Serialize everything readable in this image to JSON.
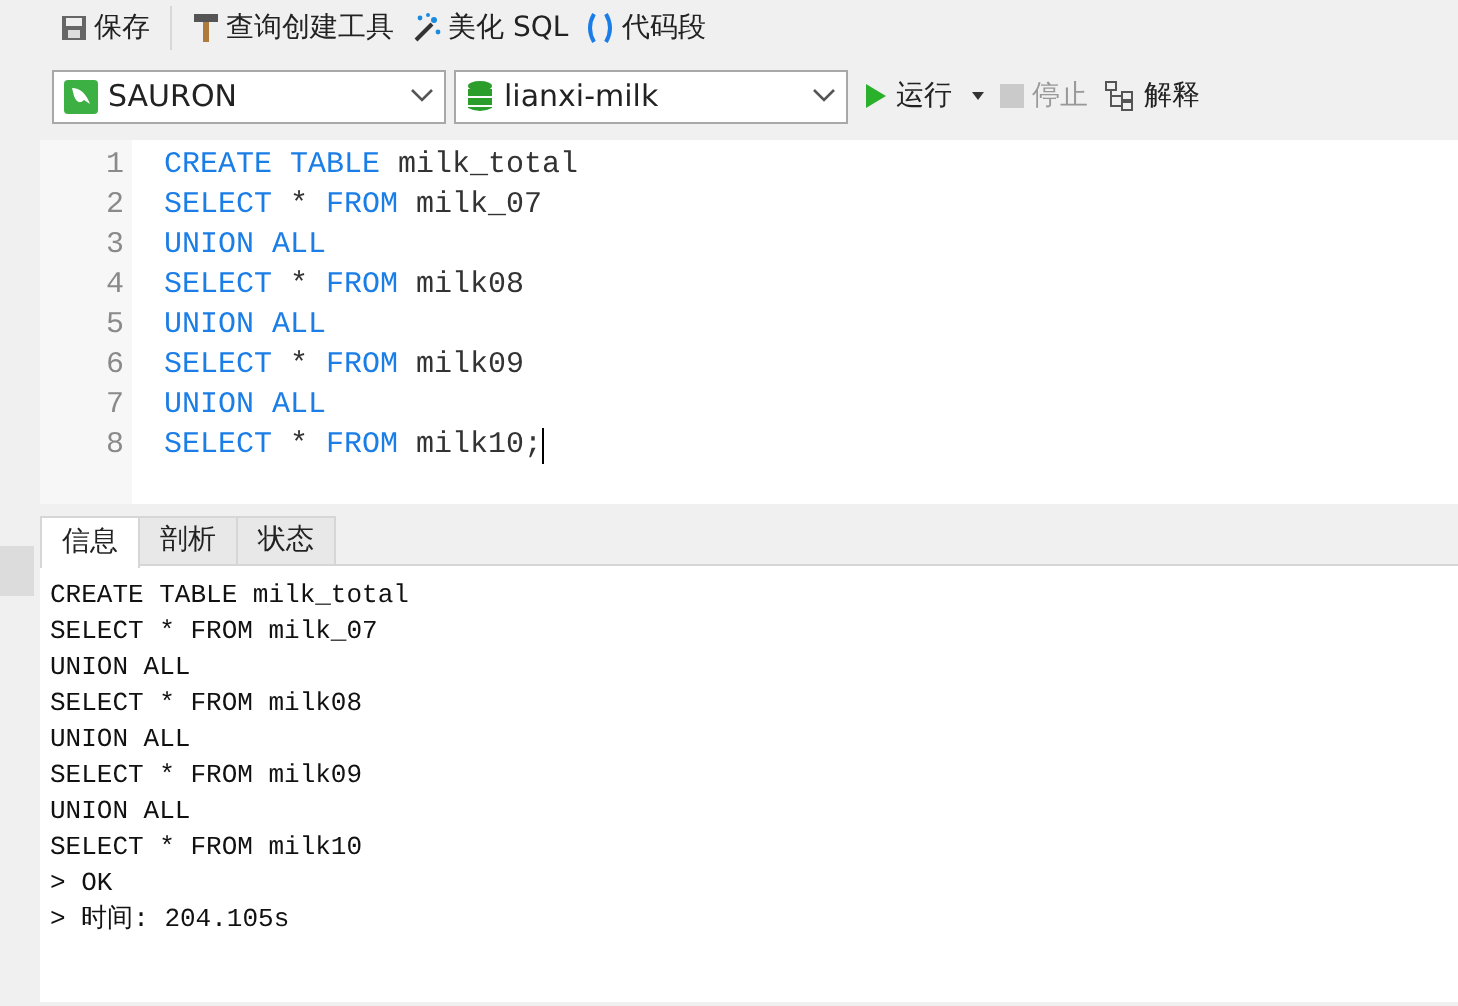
{
  "toolbar": [
    {
      "kind": "save",
      "label": "保存"
    },
    {
      "kind": "builder",
      "label": "查询创建工具"
    },
    {
      "kind": "beautify",
      "label": "美化 SQL"
    },
    {
      "kind": "snippet",
      "label": "代码段"
    }
  ],
  "connection": {
    "value": "SAURON"
  },
  "database": {
    "value": "lianxi-milk"
  },
  "actions": [
    {
      "kind": "run",
      "label": "运行",
      "disabled": false
    },
    {
      "kind": "stop",
      "label": "停止",
      "disabled": true
    },
    {
      "kind": "explain",
      "label": "解释",
      "disabled": false
    }
  ],
  "editor": {
    "lines": [
      {
        "number": "1",
        "cursor": false,
        "tokens": [
          {
            "kind": "keyword",
            "text": "CREATE TABLE"
          },
          {
            "kind": "plain",
            "text": "milk_total"
          }
        ]
      },
      {
        "number": "2",
        "cursor": false,
        "tokens": [
          {
            "kind": "keyword",
            "text": "SELECT"
          },
          {
            "kind": "plain",
            "text": "*"
          },
          {
            "kind": "keyword",
            "text": "FROM"
          },
          {
            "kind": "plain",
            "text": "milk_07"
          }
        ]
      },
      {
        "number": "3",
        "cursor": false,
        "tokens": [
          {
            "kind": "keyword",
            "text": "UNION ALL"
          }
        ]
      },
      {
        "number": "4",
        "cursor": false,
        "tokens": [
          {
            "kind": "keyword",
            "text": "SELECT"
          },
          {
            "kind": "plain",
            "text": "*"
          },
          {
            "kind": "keyword",
            "text": "FROM"
          },
          {
            "kind": "plain",
            "text": "milk08"
          }
        ]
      },
      {
        "number": "5",
        "cursor": false,
        "tokens": [
          {
            "kind": "keyword",
            "text": "UNION ALL"
          }
        ]
      },
      {
        "number": "6",
        "cursor": false,
        "tokens": [
          {
            "kind": "keyword",
            "text": "SELECT"
          },
          {
            "kind": "plain",
            "text": "*"
          },
          {
            "kind": "keyword",
            "text": "FROM"
          },
          {
            "kind": "plain",
            "text": "milk09"
          }
        ]
      },
      {
        "number": "7",
        "cursor": false,
        "tokens": [
          {
            "kind": "keyword",
            "text": "UNION ALL"
          }
        ]
      },
      {
        "number": "8",
        "cursor": true,
        "tokens": [
          {
            "kind": "keyword",
            "text": "SELECT"
          },
          {
            "kind": "plain",
            "text": "*"
          },
          {
            "kind": "keyword",
            "text": "FROM"
          },
          {
            "kind": "plain",
            "text": "milk10;"
          }
        ]
      }
    ]
  },
  "result_tabs": [
    {
      "label": "信息",
      "selected": true
    },
    {
      "label": "剖析",
      "selected": false
    },
    {
      "label": "状态",
      "selected": false
    }
  ],
  "messages": [
    "CREATE TABLE milk_total",
    "SELECT * FROM milk_07",
    "UNION ALL",
    "SELECT * FROM milk08",
    "UNION ALL",
    "SELECT * FROM milk09",
    "UNION ALL",
    "SELECT * FROM milk10",
    "> OK",
    "> 时间: 204.105s"
  ]
}
